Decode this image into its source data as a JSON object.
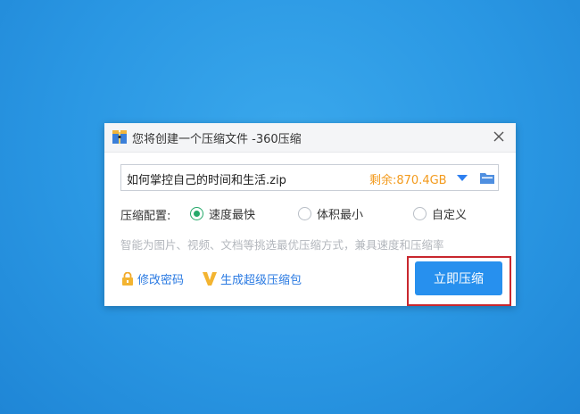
{
  "window": {
    "title": "您将创建一个压缩文件 -360压缩",
    "app_icon": "archive-icon",
    "close_icon": "close-icon"
  },
  "file": {
    "name": "如何掌控自己的时间和生活.zip",
    "remaining_space": "剩余:870.4GB",
    "dropdown_icon": "triangle-down-icon",
    "folder_icon": "folder-icon"
  },
  "config": {
    "label": "压缩配置:",
    "options": [
      {
        "label": "速度最快",
        "selected": true
      },
      {
        "label": "体积最小",
        "selected": false
      },
      {
        "label": "自定义",
        "selected": false
      }
    ],
    "hint": "智能为图片、视频、文档等挑选最优压缩方式，兼具速度和压缩率"
  },
  "actions": {
    "change_password": "修改密码",
    "super_package": "生成超级压缩包",
    "compress_now": "立即压缩"
  },
  "colors": {
    "accent": "#2790ee",
    "remaining": "#f39a1c",
    "radio_selected": "#25a96a",
    "highlight": "#c8272e",
    "link": "#2a7ae2"
  }
}
